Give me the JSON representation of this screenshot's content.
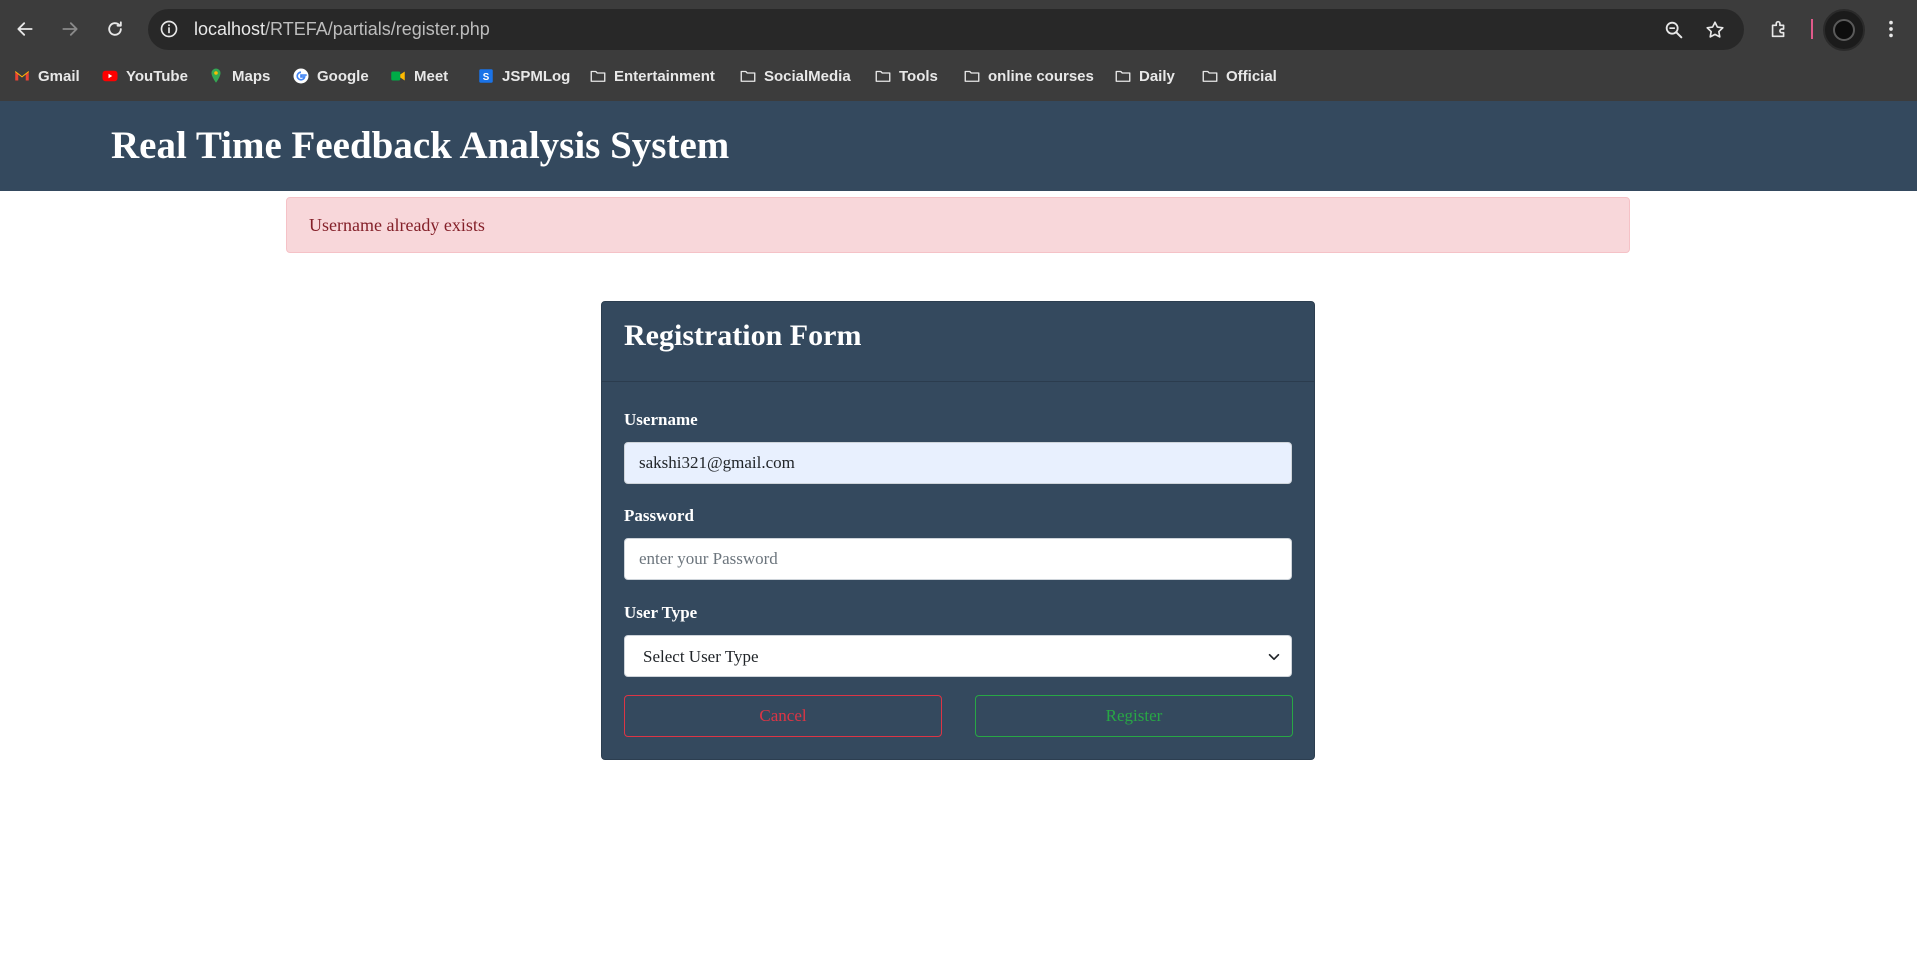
{
  "browser": {
    "url_host": "localhost",
    "url_path": "/RTEFA/partials/register.php",
    "bookmarks": [
      {
        "label": "Gmail",
        "icon": "gmail-icon"
      },
      {
        "label": "YouTube",
        "icon": "youtube-icon"
      },
      {
        "label": "Maps",
        "icon": "maps-icon"
      },
      {
        "label": "Google",
        "icon": "google-icon"
      },
      {
        "label": "Meet",
        "icon": "meet-icon"
      },
      {
        "label": "JSPMLog",
        "icon": "jspmlog-icon"
      },
      {
        "label": "Entertainment",
        "icon": "folder-icon"
      },
      {
        "label": "SocialMedia",
        "icon": "folder-icon"
      },
      {
        "label": "Tools",
        "icon": "folder-icon"
      },
      {
        "label": "online courses",
        "icon": "folder-icon"
      },
      {
        "label": "Daily",
        "icon": "folder-icon"
      },
      {
        "label": "Official",
        "icon": "folder-icon"
      }
    ]
  },
  "header": {
    "title": "Real Time Feedback Analysis System"
  },
  "alert": {
    "message": "Username already exists"
  },
  "form": {
    "title": "Registration Form",
    "username_label": "Username",
    "username_value": "sakshi321@gmail.com",
    "password_label": "Password",
    "password_placeholder": "enter your Password",
    "usertype_label": "User Type",
    "usertype_selected": "Select User Type",
    "cancel_label": "Cancel",
    "register_label": "Register"
  },
  "colors": {
    "header_bg": "#34495e",
    "alert_bg": "#f8d7da",
    "alert_text": "#842029",
    "cancel": "#dc3545",
    "register": "#28a745"
  }
}
